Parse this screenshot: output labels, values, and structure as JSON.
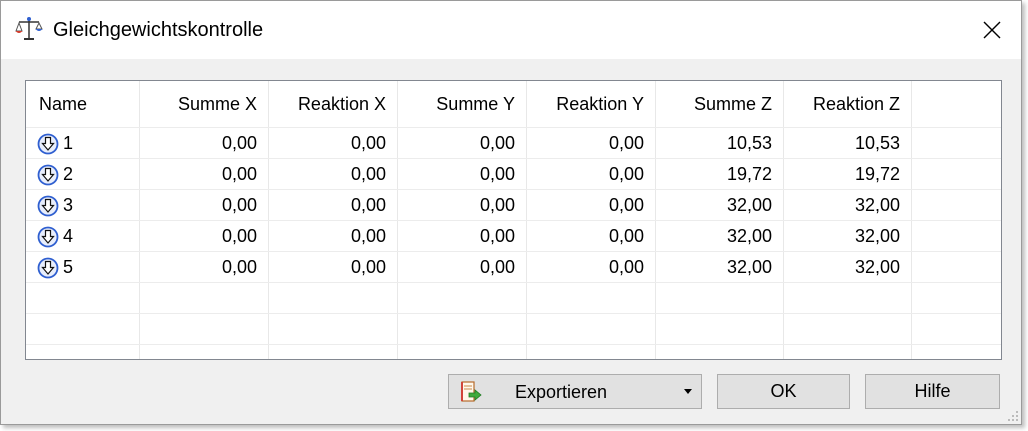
{
  "window": {
    "title": "Gleichgewichtskontrolle"
  },
  "table": {
    "columns": [
      "Name",
      "Summe X",
      "Reaktion X",
      "Summe Y",
      "Reaktion Y",
      "Summe Z",
      "Reaktion Z"
    ],
    "rows": [
      {
        "name": "1",
        "sum_x": "0,00",
        "react_x": "0,00",
        "sum_y": "0,00",
        "react_y": "0,00",
        "sum_z": "10,53",
        "react_z": "10,53"
      },
      {
        "name": "2",
        "sum_x": "0,00",
        "react_x": "0,00",
        "sum_y": "0,00",
        "react_y": "0,00",
        "sum_z": "19,72",
        "react_z": "19,72"
      },
      {
        "name": "3",
        "sum_x": "0,00",
        "react_x": "0,00",
        "sum_y": "0,00",
        "react_y": "0,00",
        "sum_z": "32,00",
        "react_z": "32,00"
      },
      {
        "name": "4",
        "sum_x": "0,00",
        "react_x": "0,00",
        "sum_y": "0,00",
        "react_y": "0,00",
        "sum_z": "32,00",
        "react_z": "32,00"
      },
      {
        "name": "5",
        "sum_x": "0,00",
        "react_x": "0,00",
        "sum_y": "0,00",
        "react_y": "0,00",
        "sum_z": "32,00",
        "react_z": "32,00"
      }
    ],
    "row_icon": "support-arrow-down-icon"
  },
  "buttons": {
    "export": "Exportieren",
    "ok": "OK",
    "help": "Hilfe"
  },
  "icons": {
    "app": "balance-scale-icon",
    "close": "close-icon",
    "export": "export-icon",
    "dropdown": "dropdown-arrow-icon"
  },
  "colors": {
    "icon_blue": "#2f5fd0",
    "app_icon_red": "#d23a2a"
  }
}
